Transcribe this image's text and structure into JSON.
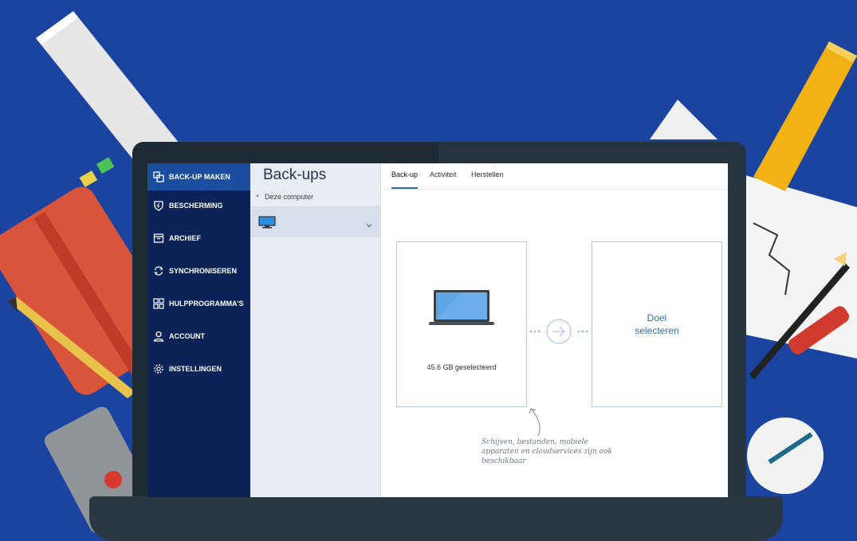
{
  "sidebar": {
    "items": [
      {
        "label": "BACK-UP MAKEN",
        "icon": "copy-icon",
        "active": true
      },
      {
        "label": "BESCHERMING",
        "icon": "shield-icon",
        "active": false
      },
      {
        "label": "ARCHIEF",
        "icon": "archive-box-icon",
        "active": false
      },
      {
        "label": "SYNCHRONISEREN",
        "icon": "sync-icon",
        "active": false
      },
      {
        "label": "HULPPROGRAMMA'S",
        "icon": "grid-tools-icon",
        "active": false
      },
      {
        "label": "ACCOUNT",
        "icon": "user-icon",
        "active": false
      },
      {
        "label": "INSTELLINGEN",
        "icon": "gear-icon",
        "active": false
      }
    ]
  },
  "panel": {
    "title": "Back-ups",
    "group_label": "Deze computer",
    "item_icon": "monitor-icon"
  },
  "tabs": [
    {
      "label": "Back-up",
      "active": true
    },
    {
      "label": "Activiteit",
      "active": false
    },
    {
      "label": "Herstellen",
      "active": false
    }
  ],
  "source": {
    "icon": "laptop-icon",
    "size_label": "45.6 GB geselecteerd"
  },
  "destination": {
    "label": "Doel selecteren"
  },
  "hint": {
    "text": "Schijven, bestanden, mobiele apparaten en cloudservices zijn ook beschikbaar"
  },
  "colors": {
    "background": "#1a44a0",
    "sidebar": "#0b2356",
    "sidebar_active": "#1c4ea0",
    "accent": "#2f68c4",
    "panel": "#e8edf5"
  }
}
